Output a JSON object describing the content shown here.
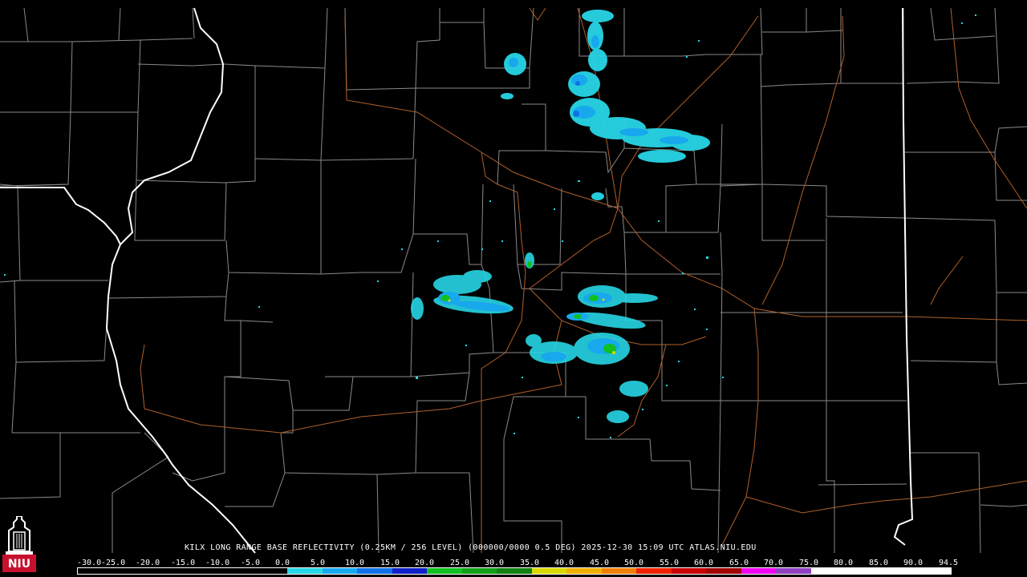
{
  "product": {
    "caption": "KILX LONG RANGE BASE REFLECTIVITY (0.25KM / 256 LEVEL) (000000/0000 0.5 DEG) 2025-12-30 15:09 UTC  ATLAS.NIU.EDU"
  },
  "logo": {
    "text": "NIU",
    "icon": "niu-tower-icon",
    "colors": {
      "tower": "#ffffff",
      "banner": "#c8102e"
    }
  },
  "map": {
    "background": "#000000",
    "county_line_color": "#8a8a8a",
    "state_line_color": "#ffffff",
    "road_color": "#b0602a",
    "radar_site": "KILX"
  },
  "legend": {
    "labels": [
      "-30.0",
      "-25.0",
      "-20.0",
      "-15.0",
      "-10.0",
      "-5.0",
      "0.0",
      "5.0",
      "10.0",
      "15.0",
      "20.0",
      "25.0",
      "30.0",
      "35.0",
      "40.0",
      "45.0",
      "50.0",
      "55.0",
      "60.0",
      "65.0",
      "70.0",
      "75.0",
      "80.0",
      "85.0",
      "90.0",
      "94.5"
    ],
    "colors": [
      "#000000",
      "#000000",
      "#000000",
      "#000000",
      "#000000",
      "#000000",
      "#27d6e6",
      "#17a8ee",
      "#1070e8",
      "#1020c8",
      "#10c020",
      "#10a018",
      "#108010",
      "#d8d800",
      "#f0b000",
      "#f08000",
      "#f02000",
      "#c80000",
      "#a00000",
      "#f000f0",
      "#9040c0",
      "#ffffff",
      "#ffffff",
      "#ffffff",
      "#ffffff"
    ]
  }
}
